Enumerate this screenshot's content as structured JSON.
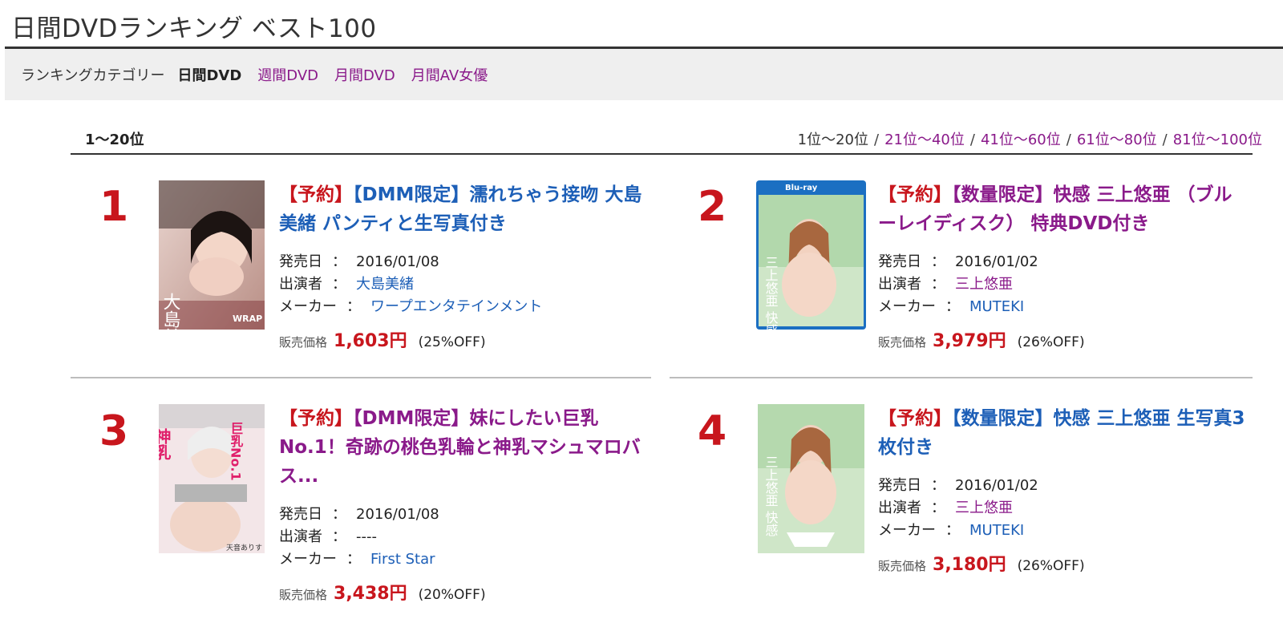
{
  "page": {
    "title": "日間DVDランキング ベスト100"
  },
  "categories": {
    "label": "ランキングカテゴリー",
    "current": "日間DVD",
    "links": [
      "週間DVD",
      "月間DVD",
      "月間AV女優"
    ]
  },
  "range": {
    "title": "1〜20位"
  },
  "pager": {
    "current": "1位〜20位",
    "links": [
      "21位〜40位",
      "41位〜60位",
      "61位〜80位",
      "81位〜100位"
    ],
    "separator": "/"
  },
  "labels": {
    "release": "発売日",
    "cast": "出演者",
    "maker": "メーカー",
    "price": "販売価格",
    "colon": "："
  },
  "items": [
    {
      "rank": "1",
      "tag": "【予約】",
      "title": "【DMM限定】濡れちゃう接吻 大島美緒 パンティと生写真付き",
      "release": "2016/01/08",
      "cast": "大島美緒",
      "maker": "ワープエンタテインメント",
      "price": "1,603円",
      "off": "(25%OFF)"
    },
    {
      "rank": "2",
      "tag": "【予約】",
      "title": "【数量限定】快感 三上悠亜 （ブルーレイディスク） 特典DVD付き",
      "release": "2016/01/02",
      "cast": "三上悠亜",
      "maker": "MUTEKI",
      "price": "3,979円",
      "off": "(26%OFF)"
    },
    {
      "rank": "3",
      "tag": "【予約】",
      "title": "【DMM限定】妹にしたい巨乳No.1！奇跡の桃色乳輪と神乳マシュマロバス...",
      "release": "2016/01/08",
      "cast": "----",
      "maker": "First Star",
      "price": "3,438円",
      "off": "(20%OFF)"
    },
    {
      "rank": "4",
      "tag": "【予約】",
      "title": "【数量限定】快感 三上悠亜 生写真3枚付き",
      "release": "2016/01/02",
      "cast": "三上悠亜",
      "maker": "MUTEKI",
      "price": "3,180円",
      "off": "(26%OFF)"
    }
  ],
  "colors": {
    "rank": "#c8161d",
    "link_blue": "#1d5fb7",
    "link_purple": "#8a1a8a",
    "category_bg": "#efefef"
  },
  "thumbnails": {
    "cover_1": {
      "text": "大島美緒",
      "badge": "WRAP"
    },
    "cover_2": {
      "text": "三上悠亜 快感",
      "badge": "Blu-ray"
    },
    "cover_3": {
      "text": "神乳 巨乳No.1",
      "badge": "天音ありす"
    },
    "cover_4": {
      "text": "三上悠亜 快感",
      "badge": ""
    }
  }
}
